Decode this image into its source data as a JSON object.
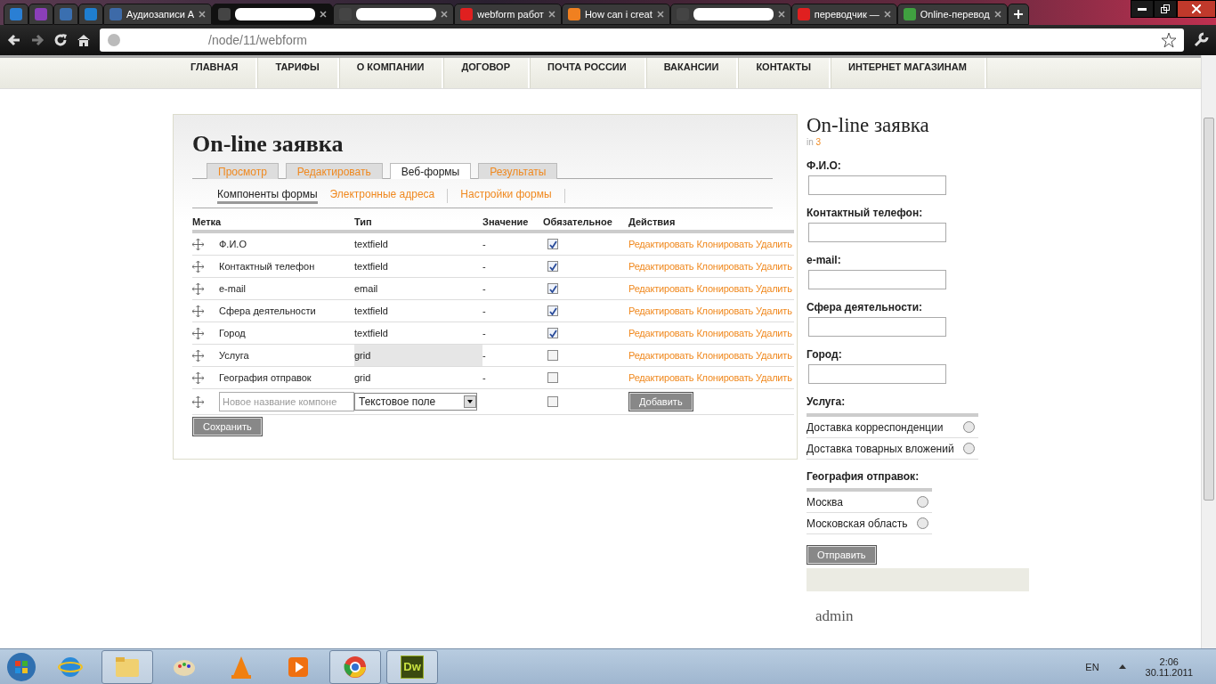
{
  "browser": {
    "tabs": [
      {
        "kind": "favicon",
        "selected": false,
        "color": "#2a7fd4"
      },
      {
        "kind": "favicon",
        "selected": false,
        "color": "#8a3fb8"
      },
      {
        "kind": "favicon",
        "selected": false,
        "color": "#3a6fb0"
      },
      {
        "kind": "favicon",
        "selected": false,
        "color": "#1f7ecf"
      },
      {
        "kind": "page",
        "title": "Аудиозаписи А",
        "selected": false,
        "color": "#3d6aa8"
      },
      {
        "kind": "redacted",
        "selected": true,
        "color": "#444444"
      },
      {
        "kind": "redacted",
        "selected": false,
        "color": "#444444"
      },
      {
        "kind": "page",
        "title": "webform работ",
        "selected": false,
        "color": "#e02020"
      },
      {
        "kind": "page",
        "title": "How can i creat",
        "selected": false,
        "color": "#f08020"
      },
      {
        "kind": "redacted",
        "selected": false,
        "color": "#444444"
      },
      {
        "kind": "page",
        "title": "переводчик —",
        "selected": false,
        "color": "#e02020"
      },
      {
        "kind": "page",
        "title": "Online-перевод",
        "selected": false,
        "color": "#40a040"
      }
    ],
    "url": "/node/11/webform"
  },
  "site_nav": [
    "ГЛАВНАЯ",
    "ТАРИФЫ",
    "О КОМПАНИИ",
    "ДОГОВОР",
    "ПОЧТА РОССИИ",
    "ВАКАНСИИ",
    "КОНТАКТЫ",
    "ИНТЕРНЕТ МАГАЗИНАМ"
  ],
  "panel": {
    "title": "On-line заявка",
    "tabs": [
      {
        "label": "Просмотр",
        "selected": false
      },
      {
        "label": "Редактировать",
        "selected": false
      },
      {
        "label": "Веб-формы",
        "selected": true
      },
      {
        "label": "Результаты",
        "selected": false
      }
    ],
    "subtabs": [
      {
        "label": "Компоненты формы",
        "selected": true
      },
      {
        "label": "Электронные адреса",
        "selected": false
      },
      {
        "label": "Настройки формы",
        "selected": false
      }
    ],
    "columns": [
      "Метка",
      "Тип",
      "Значение",
      "Обязательное",
      "Действия"
    ],
    "rows": [
      {
        "label": "Ф.И.О",
        "type": "textfield",
        "value": "-",
        "required": true,
        "highlighted": false,
        "actions": [
          "Редактировать",
          "Клонировать",
          "Удалить"
        ]
      },
      {
        "label": "Контактный телефон",
        "type": "textfield",
        "value": "-",
        "required": true,
        "highlighted": false,
        "actions": [
          "Редактировать",
          "Клонировать",
          "Удалить"
        ]
      },
      {
        "label": "e-mail",
        "type": "email",
        "value": "-",
        "required": true,
        "highlighted": false,
        "actions": [
          "Редактировать",
          "Клонировать",
          "Удалить"
        ]
      },
      {
        "label": "Сфера деятельности",
        "type": "textfield",
        "value": "-",
        "required": true,
        "highlighted": false,
        "actions": [
          "Редактировать",
          "Клонировать",
          "Удалить"
        ]
      },
      {
        "label": "Город",
        "type": "textfield",
        "value": "-",
        "required": true,
        "highlighted": false,
        "actions": [
          "Редактировать",
          "Клонировать",
          "Удалить"
        ]
      },
      {
        "label": "Услуга",
        "type": "grid",
        "value": "-",
        "required": false,
        "highlighted": true,
        "actions": [
          "Редактировать",
          "Клонировать",
          "Удалить"
        ]
      },
      {
        "label": "География отправок",
        "type": "grid",
        "value": "-",
        "required": false,
        "highlighted": false,
        "actions": [
          "Редактировать",
          "Клонировать",
          "Удалить"
        ]
      }
    ],
    "new_row": {
      "placeholder": "Новое название компоне",
      "type_value": "Текстовое поле",
      "required": false,
      "button": "Добавить"
    },
    "save_button": "Сохранить"
  },
  "sidebar": {
    "title": "On-line заявка",
    "meta_prefix": "in",
    "meta_link": "3",
    "fields": [
      "Ф.И.О:",
      "Контактный телефон:",
      "e-mail:",
      "Сфера деятельности:",
      "Город:"
    ],
    "radio_groups": [
      {
        "label": "Услуга:",
        "options": [
          {
            "label": "Доставка корреспонденции",
            "selected": false
          },
          {
            "label": "Доставка товарных вложений",
            "selected": false
          }
        ]
      },
      {
        "label": "География отправок:",
        "options": [
          {
            "label": "Москва",
            "selected": false
          },
          {
            "label": "Московская область",
            "selected": false
          }
        ]
      }
    ],
    "submit": "Отправить",
    "user": "admin"
  },
  "taskbar": {
    "apps": [
      {
        "kind": "ie",
        "running": false
      },
      {
        "kind": "folder",
        "running": true
      },
      {
        "kind": "paint",
        "running": false
      },
      {
        "kind": "cone",
        "running": false
      },
      {
        "kind": "player",
        "running": false
      },
      {
        "kind": "chrome",
        "running": true
      },
      {
        "kind": "dw",
        "running": true,
        "text": "Dw"
      }
    ],
    "lang": "EN",
    "time": "2:06",
    "date": "30.11.2011"
  }
}
